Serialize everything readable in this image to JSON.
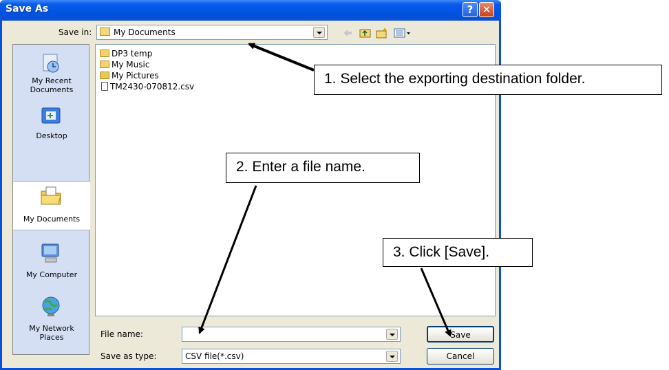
{
  "window": {
    "title": "Save As",
    "help_glyph": "?",
    "close_glyph": "✕"
  },
  "toolbar": {
    "save_in_label": "Save in:",
    "save_in_value": "My Documents",
    "icons": [
      "back-icon",
      "up-folder-icon",
      "new-folder-icon",
      "views-menu-icon"
    ]
  },
  "places": [
    {
      "label": "My Recent\nDocuments",
      "icon": "recent-documents-icon",
      "selected": false
    },
    {
      "label": "Desktop",
      "icon": "desktop-icon",
      "selected": false
    },
    {
      "label": "My Documents",
      "icon": "my-documents-icon",
      "selected": true
    },
    {
      "label": "My Computer",
      "icon": "my-computer-icon",
      "selected": false
    },
    {
      "label": "My Network\nPlaces",
      "icon": "network-places-icon",
      "selected": false
    }
  ],
  "files": [
    {
      "name": "DP3 temp",
      "icon": "folder-icon"
    },
    {
      "name": "My Music",
      "icon": "music-folder-icon"
    },
    {
      "name": "My Pictures",
      "icon": "pictures-folder-icon"
    },
    {
      "name": "TM2430-070812.csv",
      "icon": "file-icon"
    }
  ],
  "form": {
    "file_name_label": "File name:",
    "file_name_value": "",
    "save_as_type_label": "Save as type:",
    "save_as_type_value": "CSV file(*.csv)",
    "save_button": "Save",
    "cancel_button": "Cancel"
  },
  "callouts": [
    "1. Select the exporting destination folder.",
    "2. Enter a file name.",
    "3. Click [Save]."
  ],
  "colors": {
    "titlebar": "#0054e3",
    "dialog_bg": "#ece9d8",
    "places_bg": "#d4dff4"
  }
}
